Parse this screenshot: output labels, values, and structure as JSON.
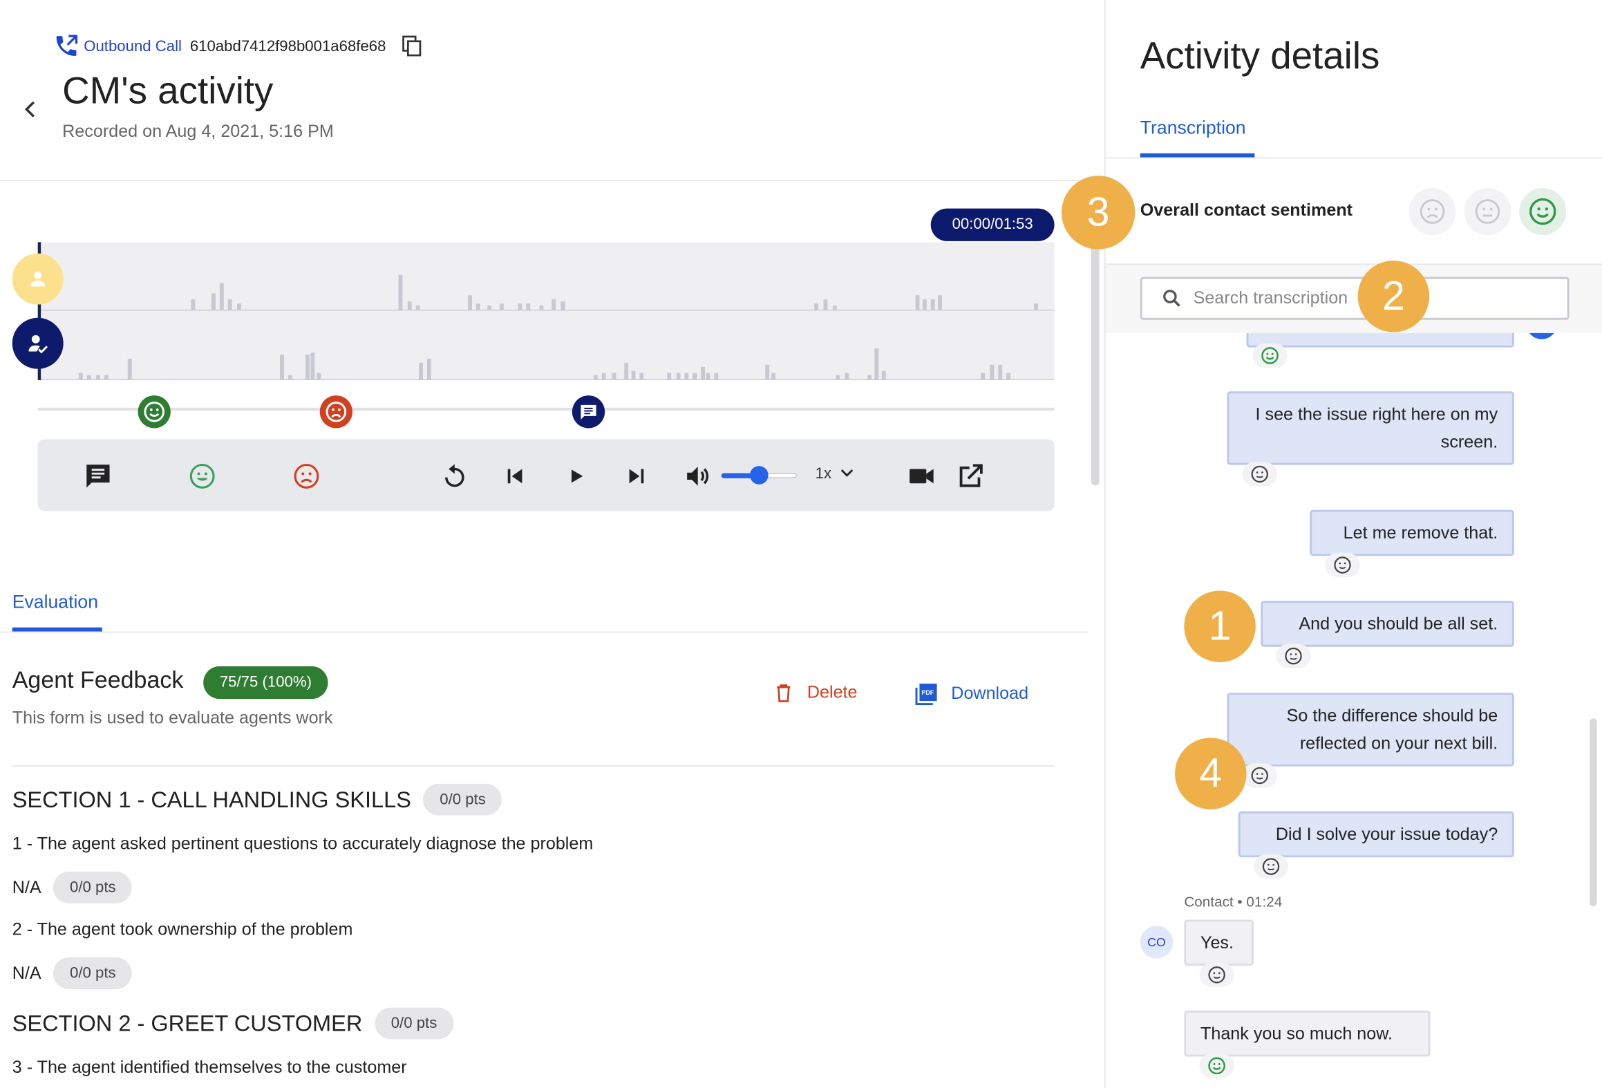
{
  "header": {
    "call_type": "Outbound Call",
    "call_id": "610abd7412f98b001a68fe68",
    "title": "CM's activity",
    "recorded": "Recorded on Aug 4, 2021, 5:16 PM"
  },
  "player": {
    "time": "00:00/01:53",
    "speed": "1x",
    "volume_fraction": 0.5,
    "markers": [
      {
        "type": "positive-sentiment",
        "color": "#2e7d32"
      },
      {
        "type": "negative-sentiment",
        "color": "#d1401f"
      },
      {
        "type": "comment",
        "color": "#0e1a6b"
      }
    ]
  },
  "tabs": {
    "evaluation": "Evaluation"
  },
  "form": {
    "title": "Agent Feedback",
    "score": "75/75 (100%)",
    "description": "This form is used to evaluate agents work",
    "delete_label": "Delete",
    "download_label": "Download",
    "sections": [
      {
        "title": "SECTION 1 - CALL HANDLING SKILLS",
        "pts": "0/0 pts",
        "questions": [
          {
            "text": "1 - The agent asked pertinent questions to accurately diagnose the problem",
            "answer": "N/A",
            "pts": "0/0 pts"
          },
          {
            "text": "2 - The agent took ownership of the problem",
            "answer": "N/A",
            "pts": "0/0 pts"
          }
        ]
      },
      {
        "title": "SECTION 2 - GREET CUSTOMER",
        "pts": "0/0 pts",
        "questions": [
          {
            "text": "3 - The agent identified themselves to the customer"
          }
        ]
      }
    ]
  },
  "details": {
    "title": "Activity details",
    "tab": "Transcription",
    "sentiment_label": "Overall contact sentiment",
    "selected_sentiment": "positive",
    "search_placeholder": "Search transcription"
  },
  "transcript": {
    "messages": [
      {
        "speaker": "agent",
        "text": "I see the issue right here on my screen.",
        "sentiment": "neutral"
      },
      {
        "speaker": "agent",
        "text": "Let me remove that.",
        "sentiment": "neutral"
      },
      {
        "speaker": "agent",
        "text": "And you should be all set.",
        "sentiment": "neutral"
      },
      {
        "speaker": "agent",
        "text": "So the difference should be reflected on your next bill.",
        "sentiment": "neutral"
      },
      {
        "speaker": "agent",
        "text": "Did I solve your issue today?",
        "sentiment": "neutral"
      },
      {
        "speaker": "contact",
        "meta": "Contact • 01:24",
        "initials": "CO",
        "text": "Yes.",
        "sentiment": "neutral"
      },
      {
        "speaker": "contact",
        "text": "Thank you so much now.",
        "sentiment": "positive"
      }
    ]
  },
  "callouts": [
    "1",
    "2",
    "3",
    "4"
  ],
  "colors": {
    "accent": "#1f5bd6",
    "callout": "#efb04a",
    "positive": "#2e7d32",
    "negative": "#d1401f",
    "navy": "#0e1a6b"
  }
}
